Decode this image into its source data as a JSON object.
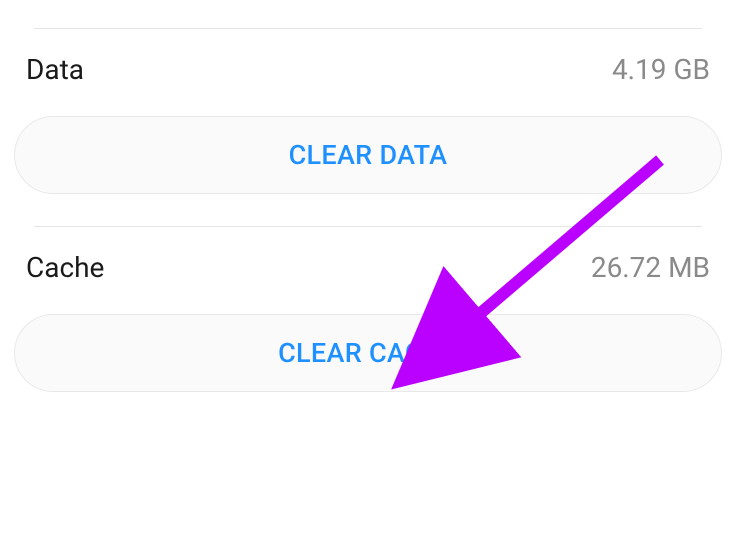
{
  "storage": {
    "data": {
      "label": "Data",
      "value": "4.19 GB",
      "button_label": "CLEAR DATA"
    },
    "cache": {
      "label": "Cache",
      "value": "26.72 MB",
      "button_label": "CLEAR CACHE"
    }
  },
  "annotation": {
    "arrow_color": "#BA00FF"
  }
}
